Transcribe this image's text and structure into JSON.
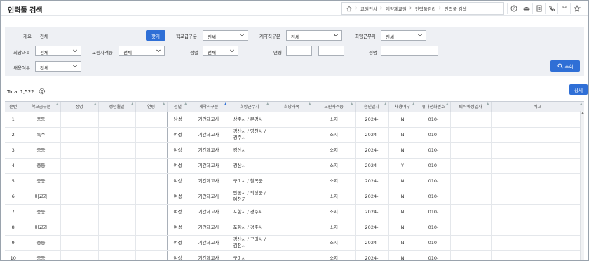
{
  "header": {
    "title": "인력풀 검색",
    "breadcrumbs": [
      "교원인사",
      "계약제교원",
      "인력풀관리",
      "인력풀 검색"
    ]
  },
  "toolbar_icons": [
    "help-icon",
    "cap-icon",
    "document-icon",
    "phone-icon",
    "save-icon",
    "star-icon"
  ],
  "filter": {
    "overview_label": "개요",
    "overview_value": "전체",
    "find_label": "찾기",
    "school_level_label": "학교급구분",
    "school_level_value": "전체",
    "contract_type_label": "계약직구분",
    "contract_type_value": "전체",
    "desired_location_label": "희망근무지",
    "desired_location_value": "전체",
    "desired_subject_label": "희망과목",
    "desired_subject_value": "전체",
    "license_label": "교원자격증",
    "license_value": "전체",
    "gender_label": "성별",
    "gender_value": "전체",
    "age_label": "연령",
    "age_sep": "-",
    "name_label": "성명",
    "hired_label": "채용여부",
    "hired_value": "전체",
    "search_label": "조회"
  },
  "list": {
    "total_label": "Total 1,522",
    "detail_label": "상세",
    "columns": [
      "순번",
      "학교급구분",
      "성명",
      "생년월일",
      "연령",
      "성별",
      "계약직구분",
      "희망근무지",
      "희망과목",
      "교원자격증",
      "승인일자",
      "채용여부",
      "휴대전화번호",
      "퇴직예정일자",
      "비고"
    ],
    "rows": [
      [
        "1",
        "중등",
        "",
        "",
        "",
        "남성",
        "기간제교사",
        "상주시 / 문경시",
        "",
        "소지",
        "2024-",
        "N",
        "010-",
        "",
        ""
      ],
      [
        "2",
        "특수",
        "",
        "",
        "",
        "여성",
        "기간제교사",
        "경산시 / 영천시 / 경주시",
        "",
        "소지",
        "2024-",
        "N",
        "010-",
        "",
        ""
      ],
      [
        "3",
        "중등",
        "",
        "",
        "",
        "여성",
        "기간제교사",
        "경산시",
        "",
        "소지",
        "2024-",
        "N",
        "010-",
        "",
        ""
      ],
      [
        "4",
        "중등",
        "",
        "",
        "",
        "여성",
        "기간제교사",
        "경산시",
        "",
        "소지",
        "2024-",
        "Y",
        "010-",
        "",
        ""
      ],
      [
        "5",
        "중등",
        "",
        "",
        "",
        "여성",
        "기간제교사",
        "구미시 / 칠곡군",
        "",
        "소지",
        "2024-",
        "N",
        "010-",
        "",
        ""
      ],
      [
        "6",
        "비교과",
        "",
        "",
        "",
        "여성",
        "기간제교사",
        "안동시 / 의성군 / 예천군",
        "",
        "소지",
        "2024-",
        "N",
        "010-",
        "",
        ""
      ],
      [
        "7",
        "중등",
        "",
        "",
        "",
        "여성",
        "기간제교사",
        "포항시 / 경주시",
        "",
        "소지",
        "2024-",
        "N",
        "010-",
        "",
        ""
      ],
      [
        "8",
        "비교과",
        "",
        "",
        "",
        "여성",
        "기간제교사",
        "포항시 / 경주시",
        "",
        "소지",
        "2024-",
        "N",
        "010-",
        "",
        ""
      ],
      [
        "9",
        "중등",
        "",
        "",
        "",
        "여성",
        "기간제교사",
        "경산시 / 구미시 / 김천시",
        "",
        "소지",
        "2024-",
        "N",
        "010-",
        "",
        ""
      ],
      [
        "10",
        "중등",
        "",
        "",
        "",
        "여성",
        "기간제교사",
        "구미시",
        "",
        "소지",
        "2024-",
        "N",
        "010-",
        "",
        ""
      ]
    ]
  }
}
